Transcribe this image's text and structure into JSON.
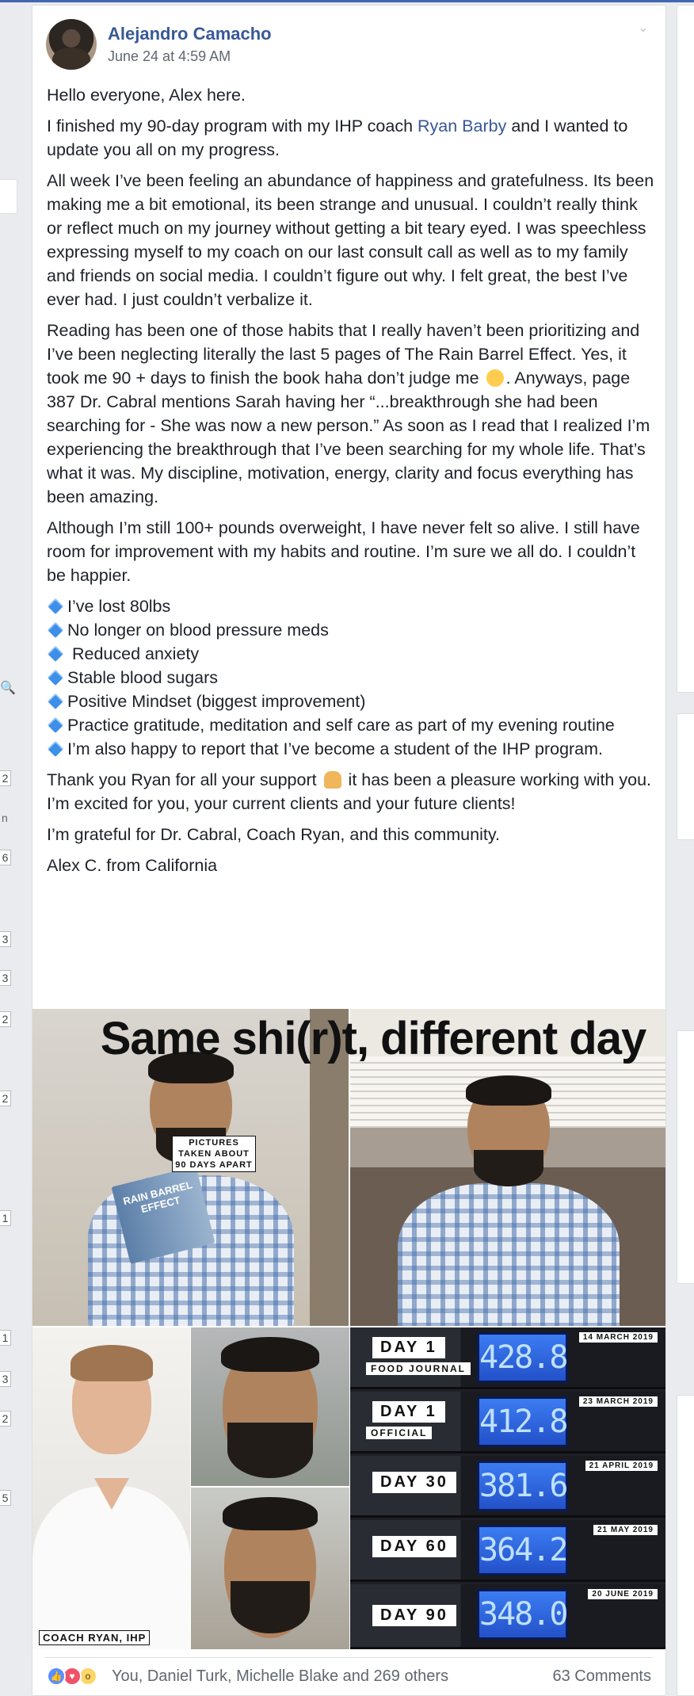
{
  "post": {
    "author": "Alejandro Camacho",
    "timestamp": "June 24 at 4:59 AM",
    "paragraphs": {
      "p1": "Hello everyone, Alex here.",
      "p2_before": "I finished my 90-day program with my IHP coach ",
      "p2_link": "Ryan Barby",
      "p2_after": " and I wanted to update you all on my progress.",
      "p3": "All week I’ve been feeling an abundance of happiness and gratefulness. Its been making me a bit emotional, its been strange and unusual. I couldn’t really think or reflect much on my journey without getting a bit teary eyed. I was speechless expressing myself to my coach on our last consult call as well as to my family and friends on social media. I couldn’t figure out why. I felt great, the best I’ve ever had. I just couldn’t verbalize it.",
      "p4_before": "Reading has been one of those habits that I really haven’t been prioritizing and I’ve been neglecting literally the last 5 pages of The Rain Barrel Effect. Yes, it took me 90 + days to finish the book haha don’t judge me",
      "p4_after": ". Anyways, page 387 Dr. Cabral mentions Sarah having her “...breakthrough she had been searching for - She was now a new person.” As soon as I read that I realized I’m experiencing the breakthrough that I’ve been searching for my whole life. That’s what it was. My discipline, motivation, energy, clarity and focus everything has been amazing.",
      "p5": "Although I’m still 100+ pounds overweight, I have never felt so alive. I still have room for improvement with my habits and routine. I’m sure we all do. I couldn’t be happier.",
      "bullets": [
        "I’ve lost 80lbs",
        "No longer on blood pressure meds",
        " Reduced anxiety",
        "Stable blood sugars",
        "Positive Mindset (biggest improvement)",
        "Practice gratitude, meditation and self care as part of my evening routine",
        "I’m also happy to report that I’ve become a student of the IHP program."
      ],
      "p6_before": "Thank you Ryan for all your support",
      "p6_after": " it has been a pleasure working with you. I’m excited for you, your current clients and your future clients!",
      "p7": "I’m grateful for Dr. Cabral, Coach Ryan, and this community.",
      "p8": "Alex C. from California"
    },
    "photos": {
      "caption": "Same shi(r)t, different day",
      "book_title": "RAIN BARREL EFFECT",
      "coach_label": "COACH RYAN, IHP",
      "pictures_label_1": "PICTURES",
      "pictures_label_2": "TAKEN ABOUT",
      "pictures_label_3": "90 DAYS APART",
      "scale_rows": [
        {
          "day": "DAY 1",
          "sub": "FOOD JOURNAL",
          "reading": "428.8",
          "date": "14 MARCH 2019"
        },
        {
          "day": "DAY 1",
          "sub": "OFFICIAL",
          "reading": "412.8",
          "date": "23 MARCH 2019"
        },
        {
          "day": "DAY 30",
          "sub": "",
          "reading": "381.6",
          "date": "21 APRIL 2019"
        },
        {
          "day": "DAY 60",
          "sub": "",
          "reading": "364.2",
          "date": "21 MAY 2019"
        },
        {
          "day": "DAY 90",
          "sub": "",
          "reading": "348.0",
          "date": "20 JUNE 2019"
        }
      ]
    },
    "footer": {
      "reactions_text": "You, Daniel Turk, Michelle Blake and 269 others",
      "comments_text": "63 Comments"
    }
  },
  "gutter": {
    "left_numbers": [
      "2",
      "6",
      "3",
      "3",
      "2",
      "2",
      "1",
      "1",
      "3",
      "2",
      "5"
    ],
    "left_letters": [
      "n"
    ]
  },
  "icons": [
    "chevron-down-icon",
    "like-reaction-icon",
    "love-reaction-icon",
    "wow-reaction-icon",
    "blue-diamond-icon",
    "drooling-face-emoji",
    "folded-hands-emoji",
    "search-icon"
  ],
  "colors": {
    "link": "#385898",
    "meta": "#616770",
    "accent": "#4267b2",
    "diamond": "#3d8fe8",
    "lcd": "#2f63dc"
  }
}
